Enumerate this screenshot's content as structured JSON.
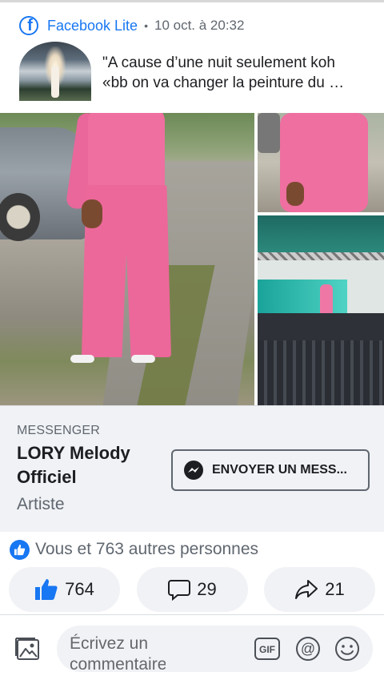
{
  "header": {
    "app_name": "Facebook Lite",
    "separator": "•",
    "timestamp": "10 oct. à 20:32"
  },
  "post": {
    "excerpt_line1": "\"A cause d’une nuit seulement koh",
    "excerpt_line2": "«bb on va changer la peinture du …"
  },
  "page_card": {
    "label": "MESSENGER",
    "name": "LORY Melody Officiel",
    "category": "Artiste",
    "message_button": "ENVOYER UN MESS..."
  },
  "reactions": {
    "summary": "Vous et 763 autres personnes"
  },
  "actions": {
    "likes": "764",
    "comments": "29",
    "shares": "21"
  },
  "composer": {
    "placeholder": "Écrivez un commentaire"
  },
  "colors": {
    "brand_blue": "#1877f2",
    "muted_text": "#606770",
    "card_bg": "#f0f2f5"
  }
}
